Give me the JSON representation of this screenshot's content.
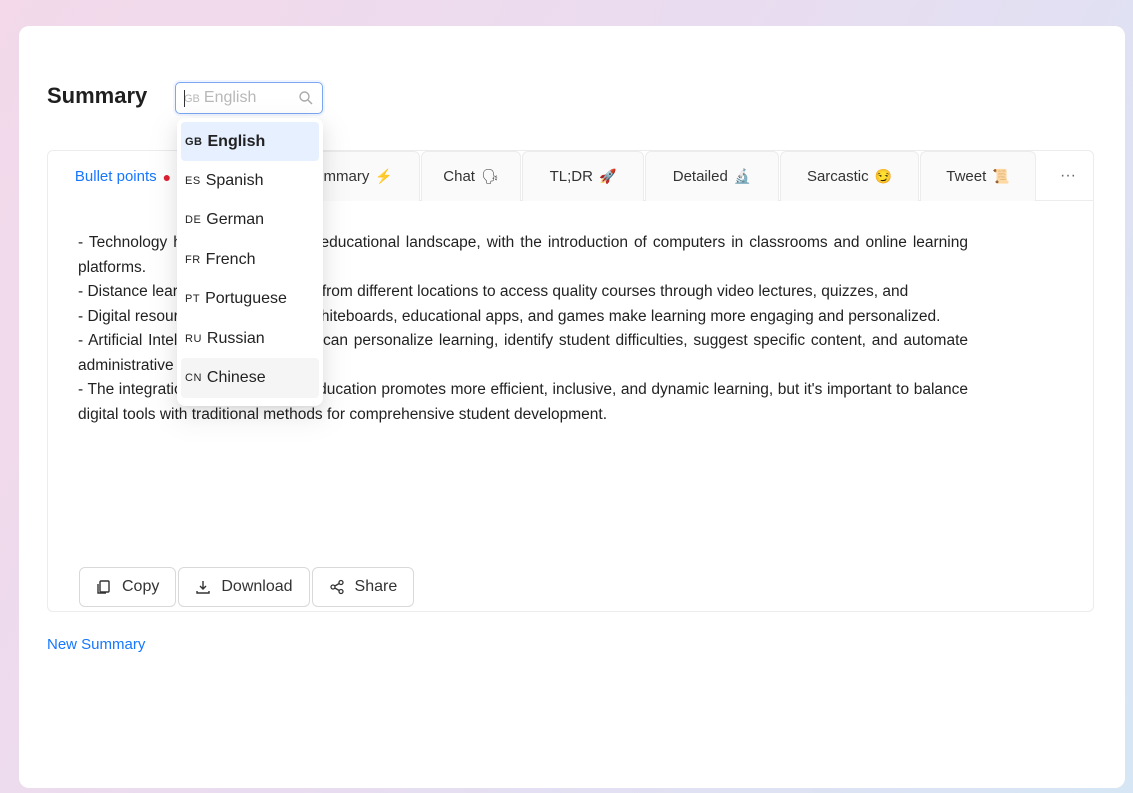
{
  "summary": {
    "title": "Summary",
    "language_input": {
      "placeholder_code": "GB",
      "placeholder_label": "English"
    }
  },
  "tabs": [
    {
      "label": "Bullet points",
      "emoji": "●"
    },
    {
      "label": "Summary",
      "emoji": "⚡"
    },
    {
      "label": "Chat",
      "emoji": "🗣"
    },
    {
      "label": "TL;DR",
      "emoji": "🚀"
    },
    {
      "label": "Detailed",
      "emoji": "🔬"
    },
    {
      "label": "Sarcastic",
      "emoji": "😏"
    },
    {
      "label": "Tweet",
      "emoji": "📜"
    }
  ],
  "more_label": "···",
  "content": {
    "lines": [
      "- Technology has transformed the educational landscape, with the introduction of computers in classrooms and online learning platforms.",
      "- Distance learning allows students from different locations to access quality courses through video lectures, quizzes, and",
      "- Digital resources like interactive whiteboards, educational apps, and games make learning more engaging and personalized.",
      "- Artificial Intelligence in education can personalize learning, identify student difficulties, suggest specific content, and automate administrative tasks.",
      "- The integration of technology in education promotes more efficient, inclusive, and dynamic learning, but it's important to balance digital tools with traditional methods for comprehensive student development."
    ]
  },
  "actions": {
    "copy": "Copy",
    "download": "Download",
    "share": "Share"
  },
  "new_summary": "New Summary",
  "languages": [
    {
      "code": "GB",
      "label": "English",
      "state": "selected"
    },
    {
      "code": "ES",
      "label": "Spanish",
      "state": ""
    },
    {
      "code": "DE",
      "label": "German",
      "state": ""
    },
    {
      "code": "FR",
      "label": "French",
      "state": ""
    },
    {
      "code": "PT",
      "label": "Portuguese",
      "state": ""
    },
    {
      "code": "RU",
      "label": "Russian",
      "state": ""
    },
    {
      "code": "CN",
      "label": "Chinese",
      "state": "hover"
    }
  ],
  "colors": {
    "accent": "#1677ff",
    "selected_bg": "#e6f0ff"
  }
}
